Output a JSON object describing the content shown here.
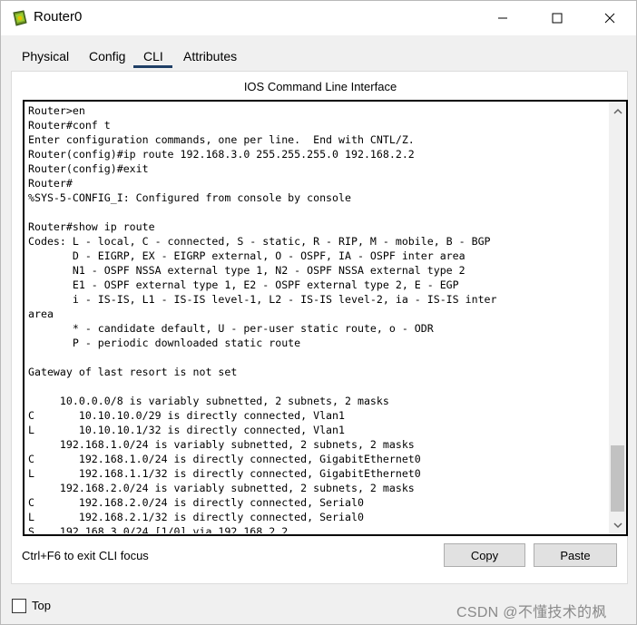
{
  "window": {
    "title": "Router0",
    "icon": "router-icon"
  },
  "tabs": [
    {
      "label": "Physical"
    },
    {
      "label": "Config"
    },
    {
      "label": "CLI"
    },
    {
      "label": "Attributes"
    }
  ],
  "active_tab": "CLI",
  "panel": {
    "title": "IOS Command Line Interface"
  },
  "terminal": {
    "lines": [
      "Router>en",
      "Router#conf t",
      "Enter configuration commands, one per line.  End with CNTL/Z.",
      "Router(config)#ip route 192.168.3.0 255.255.255.0 192.168.2.2",
      "Router(config)#exit",
      "Router#",
      "%SYS-5-CONFIG_I: Configured from console by console",
      "",
      "Router#show ip route",
      "Codes: L - local, C - connected, S - static, R - RIP, M - mobile, B - BGP",
      "       D - EIGRP, EX - EIGRP external, O - OSPF, IA - OSPF inter area",
      "       N1 - OSPF NSSA external type 1, N2 - OSPF NSSA external type 2",
      "       E1 - OSPF external type 1, E2 - OSPF external type 2, E - EGP",
      "       i - IS-IS, L1 - IS-IS level-1, L2 - IS-IS level-2, ia - IS-IS inter",
      "area",
      "       * - candidate default, U - per-user static route, o - ODR",
      "       P - periodic downloaded static route",
      "",
      "Gateway of last resort is not set",
      "",
      "     10.0.0.0/8 is variably subnetted, 2 subnets, 2 masks",
      "C       10.10.10.0/29 is directly connected, Vlan1",
      "L       10.10.10.1/32 is directly connected, Vlan1",
      "     192.168.1.0/24 is variably subnetted, 2 subnets, 2 masks",
      "C       192.168.1.0/24 is directly connected, GigabitEthernet0",
      "L       192.168.1.1/32 is directly connected, GigabitEthernet0",
      "     192.168.2.0/24 is variably subnetted, 2 subnets, 2 masks",
      "C       192.168.2.0/24 is directly connected, Serial0",
      "L       192.168.2.1/32 is directly connected, Serial0",
      "S    192.168.3.0/24 [1/0] via 192.168.2.2"
    ]
  },
  "footer": {
    "hint": "Ctrl+F6 to exit CLI focus",
    "copy_label": "Copy",
    "paste_label": "Paste",
    "top_label": "Top",
    "top_checked": false,
    "watermark": "CSDN @不懂技术的枫"
  },
  "colors": {
    "tab_underline": "#1f3f66",
    "watermark": "#8a8a8a"
  }
}
